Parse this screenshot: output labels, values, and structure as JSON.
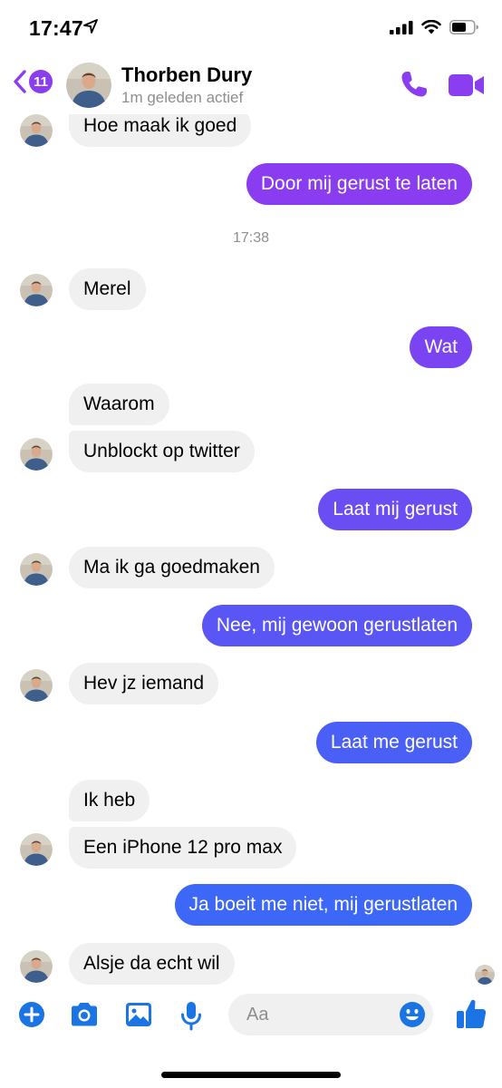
{
  "status_bar": {
    "time": "17:47"
  },
  "header": {
    "unread_count": "11",
    "contact_name": "Thorben Dury",
    "contact_status": "1m geleden actief"
  },
  "thread": {
    "timestamp": "17:38",
    "messages": [
      {
        "side": "in",
        "text": "Hoe maak ik goed"
      },
      {
        "side": "out",
        "text": "Door mij gerust te laten",
        "color": "#8a3cf0"
      },
      {
        "side": "in",
        "text": "Merel"
      },
      {
        "side": "out",
        "text": "Wat",
        "color": "#7a44f3"
      },
      {
        "side": "in",
        "text": "Waarom"
      },
      {
        "side": "in",
        "text": "Unblockt op twitter"
      },
      {
        "side": "out",
        "text": "Laat mij gerust",
        "color": "#6a4ef4"
      },
      {
        "side": "in",
        "text": "Ma ik ga goedmaken"
      },
      {
        "side": "out",
        "text": "Nee, mij gewoon gerustlaten",
        "color": "#5a56f5"
      },
      {
        "side": "in",
        "text": "Hev jz iemand"
      },
      {
        "side": "out",
        "text": "Laat me gerust",
        "color": "#4a5ff6"
      },
      {
        "side": "in",
        "text": "Ik heb"
      },
      {
        "side": "in",
        "text": "Een iPhone 12 pro max"
      },
      {
        "side": "out",
        "text": "Ja boeit me niet, mij gerustlaten",
        "color": "#3d67f6"
      },
      {
        "side": "in",
        "text": "Alsje da echt wil"
      }
    ]
  },
  "composer": {
    "placeholder": "Aa",
    "icons": [
      "plus-icon",
      "camera-icon",
      "image-icon",
      "microphone-icon",
      "emoji-icon",
      "thumbs-up-icon"
    ]
  },
  "colors": {
    "accent_purple": "#8a3ef0",
    "accent_blue": "#1b74e4",
    "incoming_bubble": "#f0f0f0"
  }
}
